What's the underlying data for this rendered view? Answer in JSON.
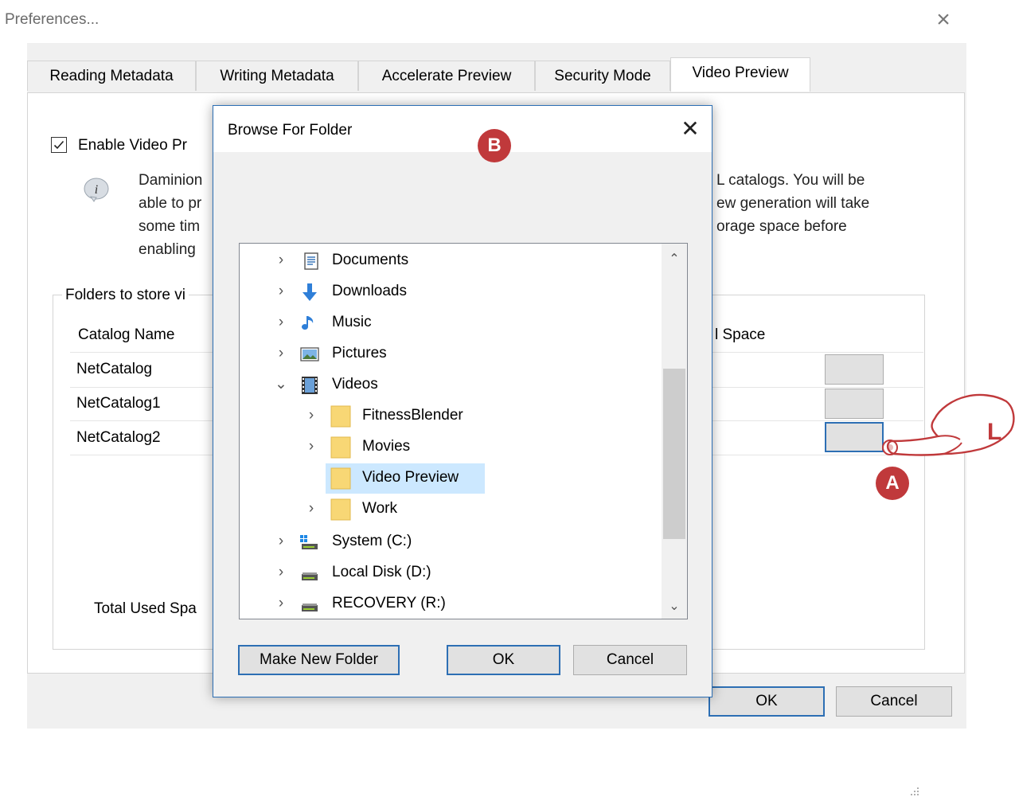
{
  "window": {
    "title": "Preferences...",
    "close": "×"
  },
  "tabs": [
    "Reading Metadata",
    "Writing Metadata",
    "Accelerate Preview",
    "Security Mode",
    "Video Preview"
  ],
  "video_preview": {
    "enable_label": "Enable Video Pr",
    "enabled": true,
    "info_left": [
      "Daminion",
      "able to pr",
      "some tim",
      "enabling"
    ],
    "info_right": [
      "L catalogs.  You will be",
      "ew generation will take",
      "orage space before"
    ],
    "group_label": "Folders to store vi",
    "columns": {
      "catalog": "Catalog Name",
      "space": "l Space"
    },
    "rows": [
      {
        "catalog": "NetCatalog"
      },
      {
        "catalog": "NetCatalog1"
      },
      {
        "catalog": "NetCatalog2"
      }
    ],
    "total_label": "Total Used Spa"
  },
  "footer": {
    "ok": "OK",
    "cancel": "Cancel"
  },
  "markers": {
    "a": "A",
    "b": "B",
    "hand_letter": "L"
  },
  "browse_dialog": {
    "title": "Browse For Folder",
    "close": "✕",
    "tree": [
      {
        "label": "Documents",
        "icon": "documents-icon",
        "level": 0,
        "chevron": "›"
      },
      {
        "label": "Downloads",
        "icon": "downloads-icon",
        "level": 0,
        "chevron": "›"
      },
      {
        "label": "Music",
        "icon": "music-icon",
        "level": 0,
        "chevron": "›"
      },
      {
        "label": "Pictures",
        "icon": "pictures-icon",
        "level": 0,
        "chevron": "›"
      },
      {
        "label": "Videos",
        "icon": "videos-icon",
        "level": 0,
        "chevron": "⌄",
        "expanded": true
      },
      {
        "label": "FitnessBlender",
        "icon": "folder-icon",
        "level": 1,
        "chevron": "›"
      },
      {
        "label": "Movies",
        "icon": "folder-icon",
        "level": 1,
        "chevron": "›"
      },
      {
        "label": "Video Preview",
        "icon": "folder-icon",
        "level": 1,
        "chevron": "",
        "selected": true
      },
      {
        "label": "Work",
        "icon": "folder-icon",
        "level": 1,
        "chevron": "›"
      },
      {
        "label": "System (C:)",
        "icon": "system-drive-icon",
        "level": 0,
        "chevron": "›"
      },
      {
        "label": "Local Disk (D:)",
        "icon": "drive-icon",
        "level": 0,
        "chevron": "›"
      },
      {
        "label": "RECOVERY (R:)",
        "icon": "drive-icon",
        "level": 0,
        "chevron": "›"
      }
    ],
    "buttons": {
      "new_folder": "Make New Folder",
      "ok": "OK",
      "cancel": "Cancel"
    },
    "scroll_up": "⌃",
    "scroll_down": "⌄"
  },
  "colors": {
    "accent": "#2d6fb4",
    "marker": "#c0393b",
    "selection": "#cce8ff",
    "folder": "#f8d775"
  }
}
